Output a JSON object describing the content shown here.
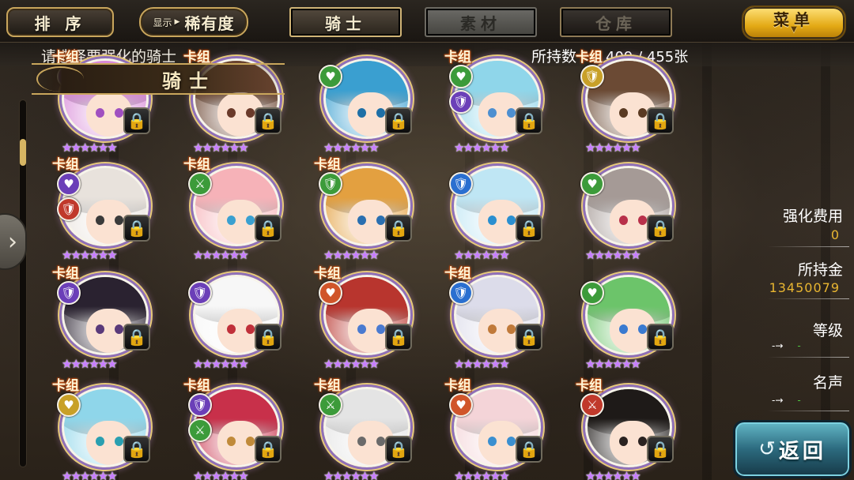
{
  "toolbar": {
    "sort_label": "排 序",
    "display_prefix": "显示",
    "rarity_label": "稀有度",
    "tabs": [
      {
        "label": "骑士",
        "state": "active"
      },
      {
        "label": "素材",
        "state": "disabled"
      },
      {
        "label": "仓库",
        "state": "dark"
      }
    ],
    "menu_label": "菜单"
  },
  "info": {
    "instruction": "请选择要强化的骑士",
    "owned_label": "所持数",
    "owned_value": "409 / 455张",
    "section_title": "骑士"
  },
  "cards": [
    {
      "deck": "卡组",
      "stars": "★★★★★★",
      "lock": "🔒",
      "attr": "🛡",
      "attr_color": "#6b3fb8",
      "attr2": "",
      "attr2_color": "",
      "hair": "#d88ad8",
      "eye": "#a050c0"
    },
    {
      "deck": "卡组",
      "stars": "★★★★★★",
      "lock": "🔒",
      "attr": "",
      "attr_color": "",
      "attr2": "",
      "attr2_color": "",
      "hair": "#6a4430",
      "eye": "#6a3a2a"
    },
    {
      "deck": "",
      "stars": "★★★★★★",
      "lock": "🔒",
      "attr": "♥",
      "attr_color": "#3c9b3a",
      "attr2": "",
      "attr2_color": "",
      "hair": "#3a9fd0",
      "eye": "#1e6fa6"
    },
    {
      "deck": "卡组",
      "stars": "★★★★★★",
      "lock": "🔒",
      "attr": "♥",
      "attr_color": "#3c9b3a",
      "attr2": "🛡",
      "attr2_color": "#6b3fb8",
      "hair": "#8fd6ea",
      "eye": "#4d8fd0"
    },
    {
      "deck": "卡组",
      "stars": "★★★★★★",
      "lock": "🔒",
      "attr": "🛡",
      "attr_color": "#c8a028",
      "attr2": "",
      "attr2_color": "",
      "hair": "#6b4a34",
      "eye": "#5a3a22"
    },
    {
      "deck": "卡组",
      "stars": "★★★★★★",
      "lock": "🔒",
      "attr": "♥",
      "attr_color": "#6b3fb8",
      "attr2": "🛡",
      "attr2_color": "#c0392b",
      "hair": "#e8e2dc",
      "eye": "#3a3a3a"
    },
    {
      "deck": "卡组",
      "stars": "★★★★★★",
      "lock": "🔒",
      "attr": "⚔",
      "attr_color": "#3c9b3a",
      "attr2": "",
      "attr2_color": "",
      "hair": "#f6b2b8",
      "eye": "#3aa0d0"
    },
    {
      "deck": "卡组",
      "stars": "★★★★★★",
      "lock": "🔒",
      "attr": "🛡",
      "attr_color": "#3c9b3a",
      "attr2": "",
      "attr2_color": "",
      "hair": "#e3a040",
      "eye": "#2a6fb0"
    },
    {
      "deck": "",
      "stars": "★★★★★★",
      "lock": "🔒",
      "attr": "🛡",
      "attr_color": "#2a6fd0",
      "attr2": "",
      "attr2_color": "",
      "hair": "#bfe6f4",
      "eye": "#2a8fd0"
    },
    {
      "deck": "",
      "stars": "★★★★★★",
      "lock": "🔒",
      "attr": "♥",
      "attr_color": "#3c9b3a",
      "attr2": "",
      "attr2_color": "",
      "hair": "#a59a96",
      "eye": "#b8304a"
    },
    {
      "deck": "卡组",
      "stars": "★★★★★★",
      "lock": "🔒",
      "attr": "🛡",
      "attr_color": "#6b3fb8",
      "attr2": "",
      "attr2_color": "",
      "hair": "#2a2230",
      "eye": "#5a3a7a"
    },
    {
      "deck": "",
      "stars": "★★★★★★",
      "lock": "🔒",
      "attr": "🛡",
      "attr_color": "#6b3fb8",
      "attr2": "",
      "attr2_color": "",
      "hair": "#f7f7f7",
      "eye": "#c0303a"
    },
    {
      "deck": "卡组",
      "stars": "★★★★★★",
      "lock": "🔒",
      "attr": "♥",
      "attr_color": "#d0552a",
      "attr2": "",
      "attr2_color": "",
      "hair": "#b8352e",
      "eye": "#4a7ad0"
    },
    {
      "deck": "卡组",
      "stars": "★★★★★★",
      "lock": "🔒",
      "attr": "🛡",
      "attr_color": "#2a6fd0",
      "attr2": "",
      "attr2_color": "",
      "hair": "#dcdcea",
      "eye": "#c07a3a"
    },
    {
      "deck": "",
      "stars": "★★★★★★",
      "lock": "🔒",
      "attr": "♥",
      "attr_color": "#3c9b3a",
      "attr2": "",
      "attr2_color": "",
      "hair": "#6cc46a",
      "eye": "#3a7ad0"
    },
    {
      "deck": "卡组",
      "stars": "★★★★★★",
      "lock": "🔒",
      "attr": "♥",
      "attr_color": "#c8a028",
      "attr2": "",
      "attr2_color": "",
      "hair": "#8fd6ea",
      "eye": "#2a9fb0"
    },
    {
      "deck": "卡组",
      "stars": "★★★★★★",
      "lock": "🔒",
      "attr": "🛡",
      "attr_color": "#6b3fb8",
      "attr2": "⚔",
      "attr2_color": "#3c9b3a",
      "hair": "#c8304a",
      "eye": "#c08a3a"
    },
    {
      "deck": "卡组",
      "stars": "★★★★★★",
      "lock": "🔒",
      "attr": "⚔",
      "attr_color": "#3c9b3a",
      "attr2": "",
      "attr2_color": "",
      "hair": "#e4e4e4",
      "eye": "#6a6a6a"
    },
    {
      "deck": "卡组",
      "stars": "★★★★★★",
      "lock": "🔒",
      "attr": "♥",
      "attr_color": "#d0552a",
      "attr2": "",
      "attr2_color": "",
      "hair": "#f4d4d8",
      "eye": "#3a8fd0"
    },
    {
      "deck": "卡组",
      "stars": "★★★★★★",
      "lock": "🔒",
      "attr": "⚔",
      "attr_color": "#c0392b",
      "attr2": "",
      "attr2_color": "",
      "hair": "#1e1a18",
      "eye": "#2a2220"
    }
  ],
  "right_panel": {
    "cost_label": "强化费用",
    "cost_value": "0",
    "gold_label": "所持金",
    "gold_value": "13450079",
    "level_label": "等级",
    "level_from": "-",
    "level_arrow": "→",
    "level_to": "-",
    "fame_label": "名声",
    "fame_from": "-",
    "fame_arrow": "→",
    "fame_to": "-"
  },
  "back_label": "返回",
  "side_tab_icon": "chevron-right-icon"
}
